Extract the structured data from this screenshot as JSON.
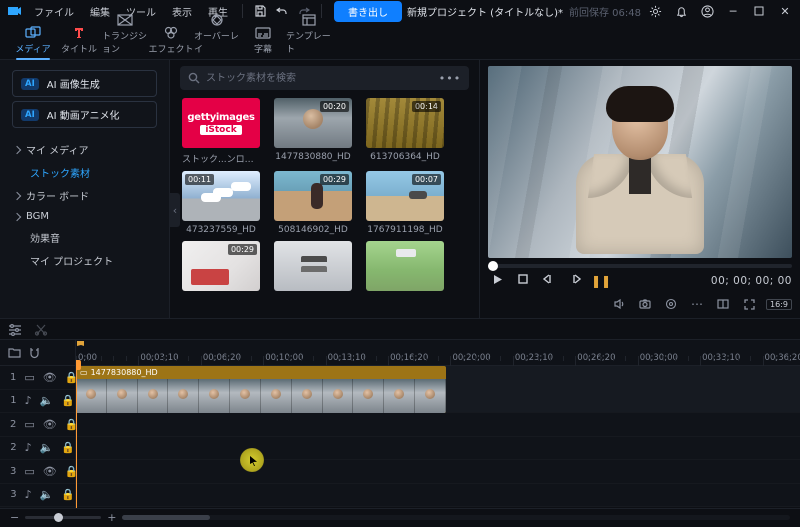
{
  "menubar": {
    "items": [
      "ファイル",
      "編集",
      "ツール",
      "表示",
      "再生"
    ]
  },
  "export_label": "書き出し",
  "title": {
    "name": "新規プロジェクト (タイトルなし)*",
    "saved": "前回保存 06:48"
  },
  "tooltabs": [
    {
      "label": "メディア",
      "icon": "media"
    },
    {
      "label": "タイトル",
      "icon": "title"
    },
    {
      "label": "トランジション",
      "icon": "transition"
    },
    {
      "label": "エフェクト",
      "icon": "effect"
    },
    {
      "label": "オーバーレイ",
      "icon": "overlay"
    },
    {
      "label": "字幕",
      "icon": "subtitle"
    },
    {
      "label": "テンプレート",
      "icon": "template"
    }
  ],
  "ai": {
    "gen": "AI 画像生成",
    "anim": "AI 動画アニメ化",
    "chip": "AI"
  },
  "tree": {
    "my_media": "マイ メディア",
    "stock": "ストック素材",
    "color": "カラー ボード",
    "bgm": "BGM",
    "sfx": "効果音",
    "my_project": "マイ プロジェクト"
  },
  "search": {
    "placeholder": "ストック素材を検索"
  },
  "cards": {
    "stock_brand_top": "gettyimages",
    "stock_brand_bottom": "iStock",
    "r0": [
      "ストック...ンロード",
      "1477830880_HD",
      "613706364_HD"
    ],
    "r1": [
      "473237559_HD",
      "508146902_HD",
      "1767911198_HD"
    ],
    "dur": {
      "c01": "00:20",
      "c02": "00:14",
      "c10": "00:11",
      "c11": "00:29",
      "c12": "00:07",
      "c20": "00:29"
    }
  },
  "preview": {
    "timecode": "00; 00; 00; 00",
    "aspect": "16:9"
  },
  "ruler_marks": [
    "0;00",
    "00;03;10",
    "00;06;20",
    "00;10;00",
    "00;13;10",
    "00;16;20",
    "00;20;00",
    "00;23;10",
    "00;26;20",
    "00;30;00",
    "00;33;10",
    "00;36;20"
  ],
  "clip": {
    "title": "1477830880_HD"
  },
  "tracks": {
    "v": [
      1,
      1,
      2,
      2,
      3,
      3
    ]
  }
}
